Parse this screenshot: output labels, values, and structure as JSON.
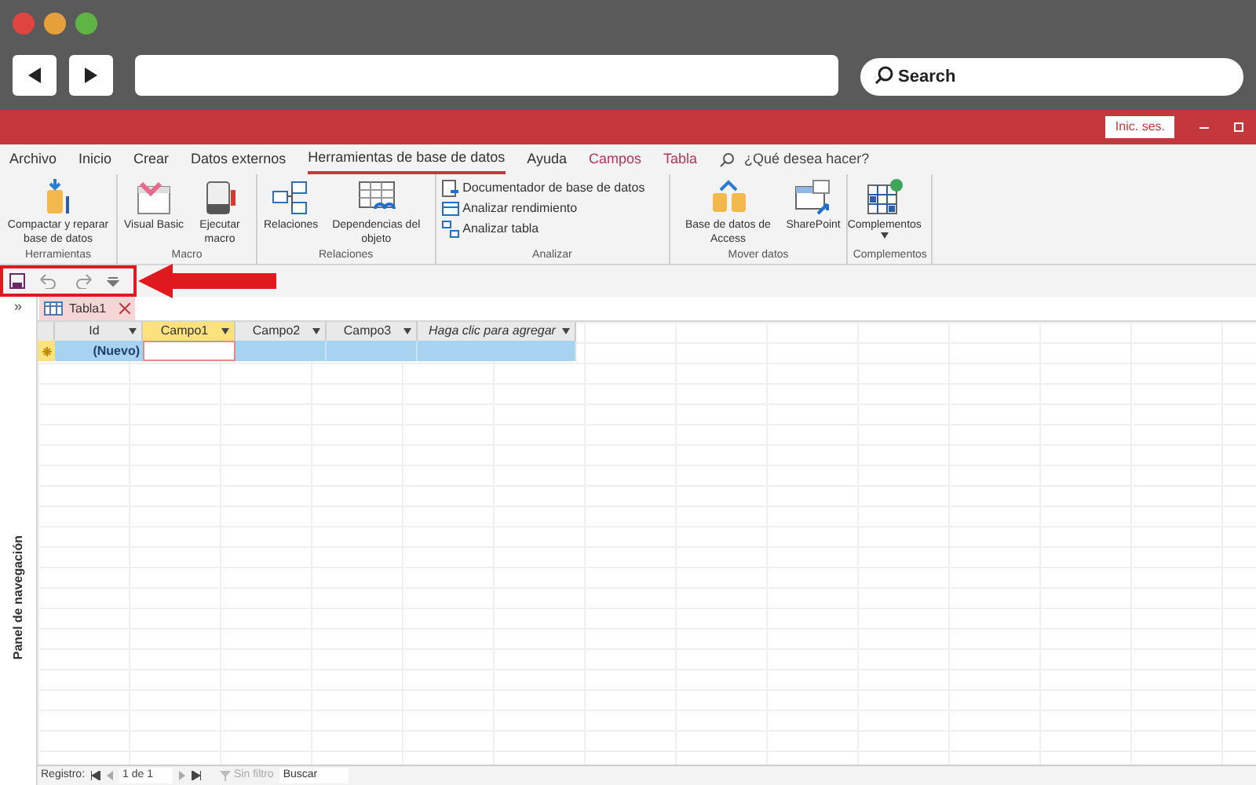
{
  "browser": {
    "search": {
      "placeholder": "Search"
    }
  },
  "titlebar": {
    "sign_in": "Inic. ses."
  },
  "ribbon_tabs": [
    {
      "label": "Archivo",
      "selected": false,
      "kind": "normal"
    },
    {
      "label": "Inicio",
      "selected": false,
      "kind": "normal"
    },
    {
      "label": "Crear",
      "selected": false,
      "kind": "normal"
    },
    {
      "label": "Datos externos",
      "selected": false,
      "kind": "normal"
    },
    {
      "label": "Herramientas de base de datos",
      "selected": true,
      "kind": "normal"
    },
    {
      "label": "Ayuda",
      "selected": false,
      "kind": "normal"
    },
    {
      "label": "Campos",
      "selected": false,
      "kind": "context"
    },
    {
      "label": "Tabla",
      "selected": false,
      "kind": "context"
    }
  ],
  "tell_me": "¿Qué desea hacer?",
  "groups": [
    {
      "label": "Herramientas",
      "kind": "large",
      "buttons": [
        {
          "label": "Compactar y reparar base de datos"
        }
      ]
    },
    {
      "label": "Macro",
      "kind": "large",
      "buttons": [
        {
          "label": "Visual Basic"
        },
        {
          "label": "Ejecutar macro"
        }
      ]
    },
    {
      "label": "Relaciones",
      "kind": "large",
      "buttons": [
        {
          "label": "Relaciones"
        },
        {
          "label": "Dependencias del objeto"
        }
      ]
    },
    {
      "label": "Analizar",
      "kind": "small",
      "buttons": [
        {
          "label": "Documentador de base de datos"
        },
        {
          "label": "Analizar rendimiento"
        },
        {
          "label": "Analizar tabla"
        }
      ]
    },
    {
      "label": "Mover datos",
      "kind": "large",
      "buttons": [
        {
          "label": "Base de datos de Access"
        },
        {
          "label": "SharePoint"
        }
      ]
    },
    {
      "label": "Complementos",
      "kind": "large",
      "buttons": [
        {
          "label": "Complementos",
          "dropdown": true
        }
      ]
    }
  ],
  "quick_access": {
    "highlighted": true
  },
  "nav_pane": {
    "toggle": "»",
    "label": "Panel de navegación"
  },
  "document_tab": {
    "label": "Tabla1"
  },
  "columns": [
    {
      "label": "Id",
      "selected": false,
      "kind": "field"
    },
    {
      "label": "Campo1",
      "selected": true,
      "kind": "field"
    },
    {
      "label": "Campo2",
      "selected": false,
      "kind": "field"
    },
    {
      "label": "Campo3",
      "selected": false,
      "kind": "field"
    },
    {
      "label": "Haga clic para agregar",
      "selected": false,
      "kind": "add"
    }
  ],
  "new_row": {
    "id": "(Nuevo)"
  },
  "status_bar": {
    "label": "Registro:",
    "position": "1 de 1",
    "filter": "Sin filtro",
    "filter_disabled": true,
    "search": {
      "placeholder": "Buscar"
    }
  }
}
